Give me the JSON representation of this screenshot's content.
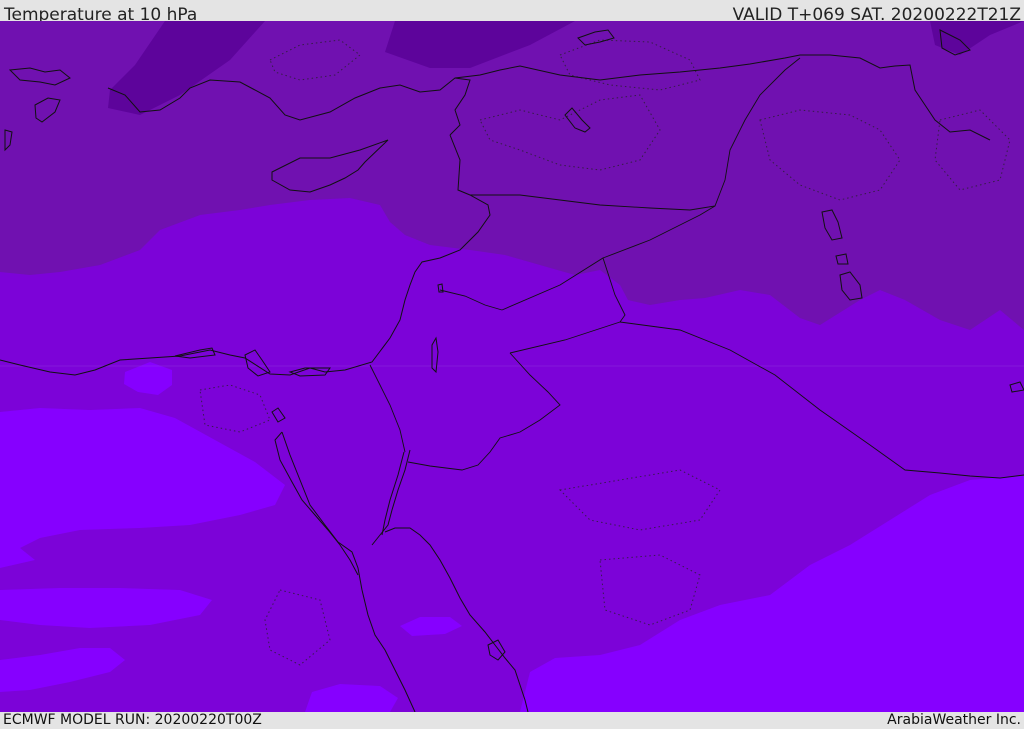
{
  "header": {
    "title": "Temperature at 10 hPa",
    "valid": "VALID T+069 SAT. 20200222T21Z"
  },
  "footer": {
    "model_run": "ECMWF MODEL RUN: 20200220T00Z",
    "credit": "ArabiaWeather Inc."
  },
  "map": {
    "parameter": "Temperature",
    "level": "10 hPa",
    "colors": {
      "band_darkest": "#5d049b",
      "band_dark": "#7011b0",
      "band_mid": "#7c03d8",
      "band_bright": "#8600ff",
      "coastline": "#111111",
      "border": "#111111"
    }
  }
}
